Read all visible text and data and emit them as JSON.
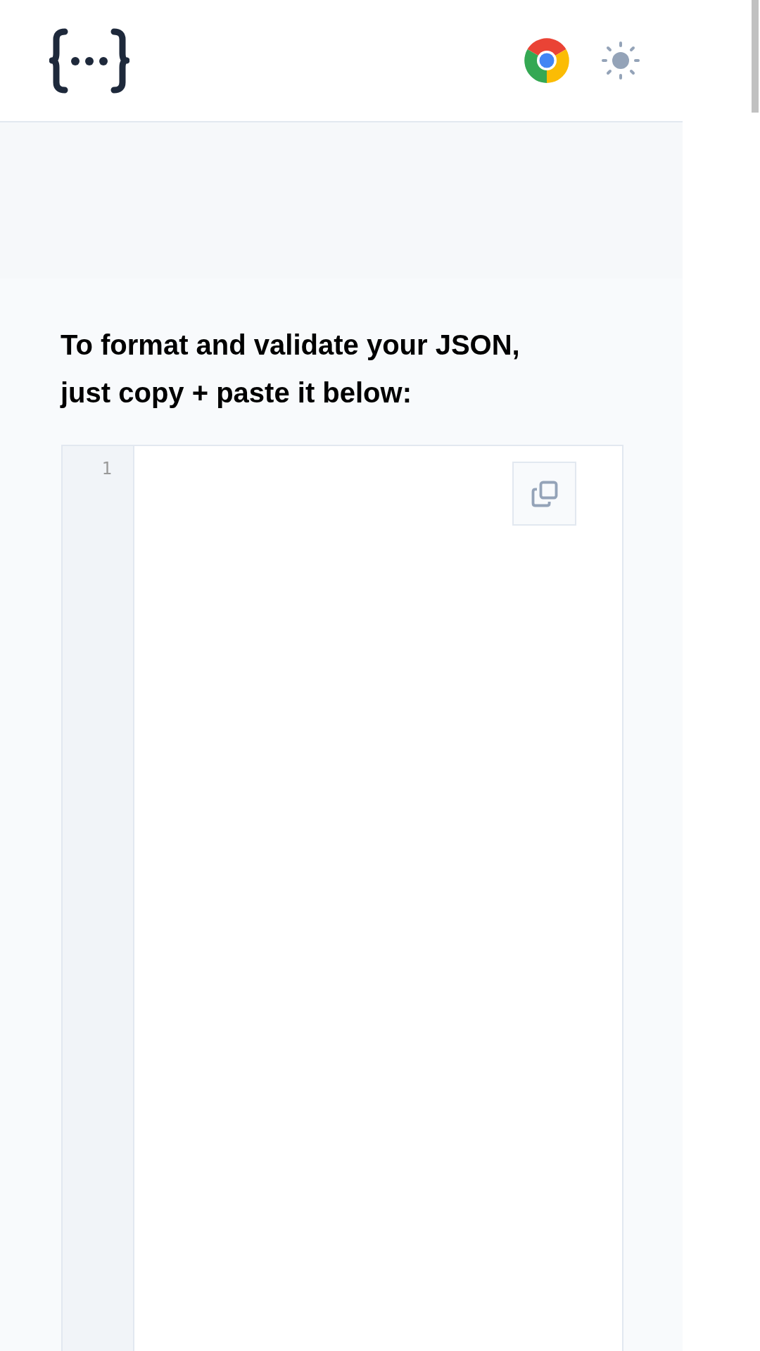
{
  "heading": "To format and validate your JSON, just copy + paste it below:",
  "editor": {
    "line_numbers": [
      "1"
    ]
  }
}
